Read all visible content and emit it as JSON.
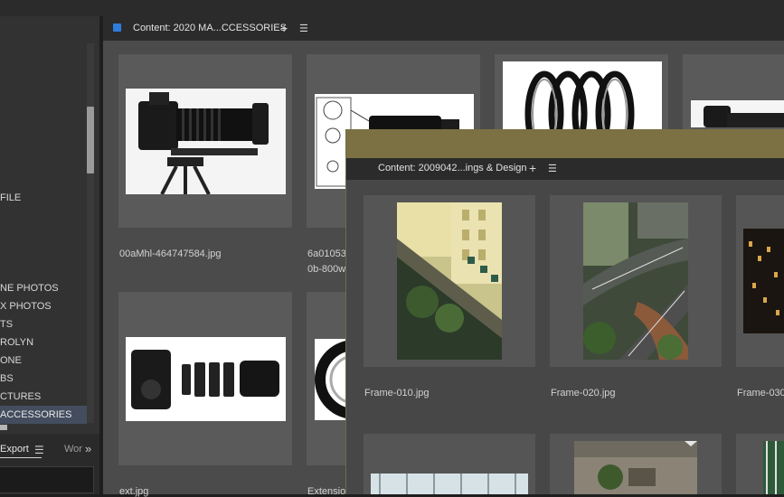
{
  "left_panel": {
    "folders": [
      {
        "label": "FILE",
        "selected": false
      },
      {
        "label": "",
        "selected": false
      },
      {
        "label": "NE PHOTOS",
        "selected": false
      },
      {
        "label": "X PHOTOS",
        "selected": false
      },
      {
        "label": "TS",
        "selected": false
      },
      {
        "label": "ROLYN",
        "selected": false
      },
      {
        "label": "ONE",
        "selected": false
      },
      {
        "label": "BS",
        "selected": false
      },
      {
        "label": "CTURES",
        "selected": false
      },
      {
        "label": " ACCESSORIES",
        "selected": true
      }
    ],
    "bottom_tabs": {
      "export_label": "Export",
      "menu_glyph": "☰",
      "workspace_label": "Wor",
      "more_glyph": "»"
    }
  },
  "content_panel": {
    "title": "Content: 2020 MA...CCESSORIES",
    "add_glyph": "+",
    "menu_glyph": "☰",
    "files": [
      {
        "name": "00aMhl-464747584.jpg"
      },
      {
        "name": "6a01053"
      },
      {
        "name": "0b-800w"
      },
      {
        "name": "ext.jpg"
      },
      {
        "name": "Extensio"
      }
    ]
  },
  "float_window": {
    "title": "Content: 2009042...ings & Design",
    "add_glyph": "+",
    "menu_glyph": "☰",
    "files": [
      {
        "name": "Frame-010.jpg"
      },
      {
        "name": "Frame-020.jpg"
      },
      {
        "name": "Frame-030"
      }
    ]
  },
  "colors": {
    "accent": "#2f7ddb",
    "float_titlebar": "#7c7143",
    "selection": "#434d5e"
  }
}
